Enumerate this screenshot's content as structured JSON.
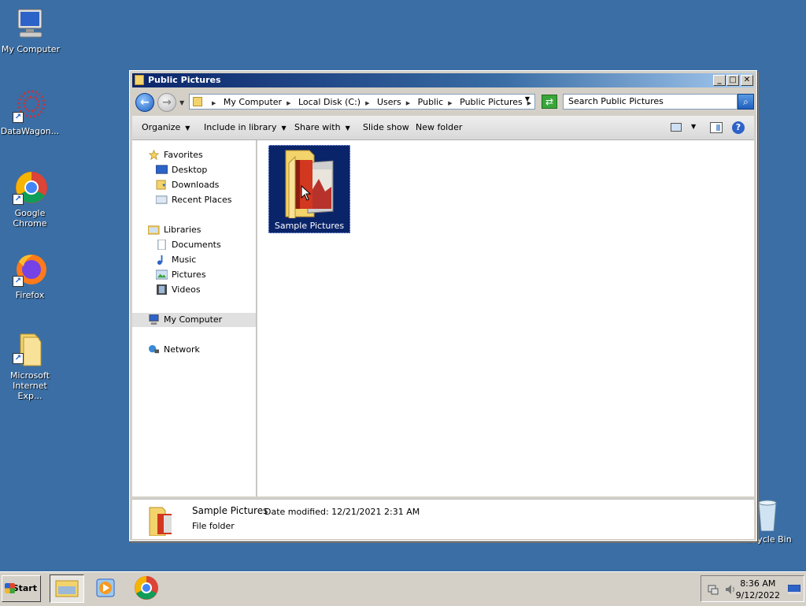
{
  "desktop": {
    "icons": [
      {
        "label": "My Computer"
      },
      {
        "label": "DataWagon..."
      },
      {
        "label": "Google Chrome"
      },
      {
        "label": "Firefox"
      },
      {
        "label": "Microsoft Internet Exp..."
      },
      {
        "label": "Recycle Bin"
      }
    ]
  },
  "window": {
    "title": "Public Pictures",
    "address": {
      "crumbs": [
        "My Computer",
        "Local Disk (C:)",
        "Users",
        "Public",
        "Public Pictures"
      ]
    },
    "search_placeholder": "Search Public Pictures",
    "toolbar": {
      "organize": "Organize",
      "include": "Include in library",
      "share": "Share with",
      "slideshow": "Slide show",
      "newfolder": "New folder"
    },
    "nav": {
      "favorites": "Favorites",
      "desktop": "Desktop",
      "downloads": "Downloads",
      "recent": "Recent Places",
      "libraries": "Libraries",
      "documents": "Documents",
      "music": "Music",
      "pictures": "Pictures",
      "videos": "Videos",
      "mycomputer": "My Computer",
      "network": "Network"
    },
    "items": [
      {
        "name": "Sample Pictures"
      }
    ],
    "details": {
      "name": "Sample Pictures",
      "date_modified": "Date modified:  12/21/2021 2:31 AM",
      "kind": "File folder"
    }
  },
  "taskbar": {
    "start": "Start",
    "time": "8:36 AM",
    "date": "9/12/2022"
  }
}
